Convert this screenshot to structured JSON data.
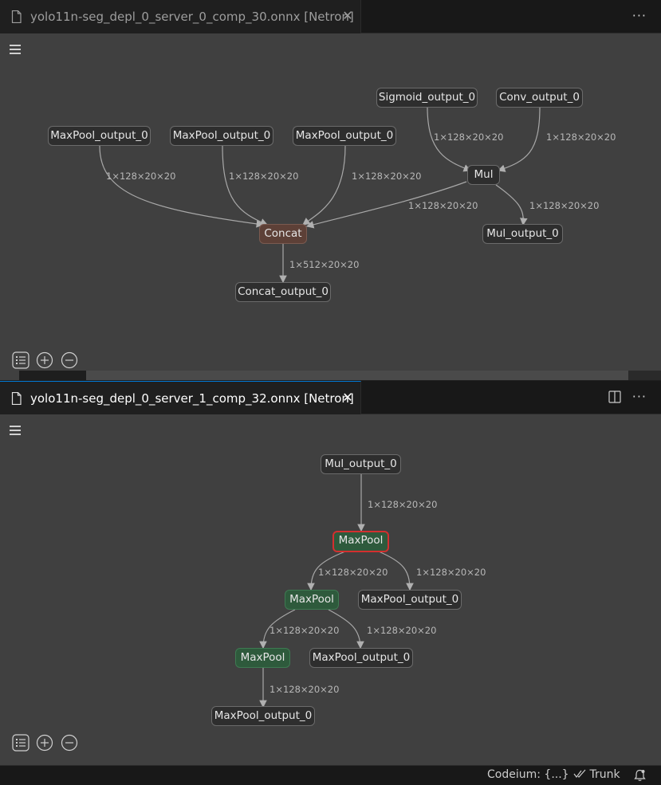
{
  "top_editor": {
    "tab_title": "yolo11n-seg_depl_0_server_0_comp_30.onnx [Netron]",
    "close_glyph": "✕",
    "more_glyph": "···",
    "graph": {
      "nodes": {
        "sigmoid_out": "Sigmoid_output_0",
        "conv_out": "Conv_output_0",
        "maxpool_out_a": "MaxPool_output_0",
        "maxpool_out_b": "MaxPool_output_0",
        "maxpool_out_c": "MaxPool_output_0",
        "mul": "Mul",
        "concat": "Concat",
        "mul_out": "Mul_output_0",
        "concat_out": "Concat_output_0"
      },
      "edges": {
        "e1": "1×128×20×20",
        "e2": "1×128×20×20",
        "e3": "1×128×20×20",
        "e4": "1×128×20×20",
        "e5": "1×128×20×20",
        "e6": "1×128×20×20",
        "e7": "1×128×20×20",
        "e8": "1×512×20×20"
      }
    }
  },
  "bottom_editor": {
    "tab_title": "yolo11n-seg_depl_0_server_1_comp_32.onnx [Netron]",
    "close_glyph": "✕",
    "more_glyph": "···",
    "graph": {
      "nodes": {
        "mul_out": "Mul_output_0",
        "maxpool_sel": "MaxPool",
        "maxpool_2": "MaxPool",
        "maxpool_out_1": "MaxPool_output_0",
        "maxpool_3": "MaxPool",
        "maxpool_out_2": "MaxPool_output_0",
        "maxpool_out_3": "MaxPool_output_0"
      },
      "edges": {
        "b1": "1×128×20×20",
        "b2": "1×128×20×20",
        "b3": "1×128×20×20",
        "b4": "1×128×20×20",
        "b5": "1×128×20×20",
        "b6": "1×128×20×20"
      }
    }
  },
  "statusbar": {
    "codeium": "Codeium: {...}",
    "branch": "Trunk"
  },
  "colors": {
    "canvas": "#404040",
    "node": "#2e2e2e",
    "concat": "#5d4037",
    "pool": "#2e5a3c",
    "selected_border": "#d32f2f"
  }
}
